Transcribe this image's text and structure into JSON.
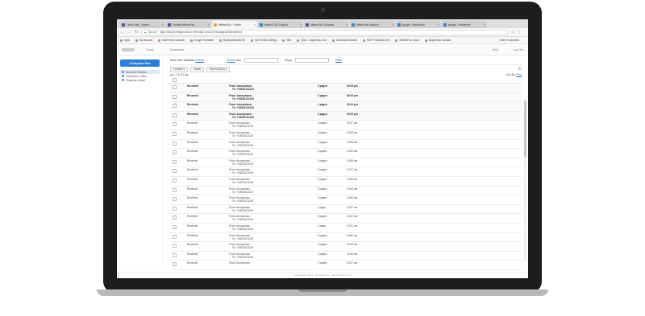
{
  "browser": {
    "tabs": [
      {
        "label": "Yahoo Mail - Receiv",
        "color": "#6b3fa0",
        "active": false
      },
      {
        "label": "Contact #MetroFax",
        "color": "#6b3fa0",
        "active": false
      },
      {
        "label": "#MetroFAX - Folder",
        "color": "#e8a23a",
        "active": true
      },
      {
        "label": "#Metro FAX Support",
        "color": "#2c8cc8",
        "active": false
      },
      {
        "label": "#MetroFAX Services",
        "color": "#6b3fa0",
        "active": false
      },
      {
        "label": "#MetroFax Inbound",
        "color": "#2c8cc8",
        "active": false
      },
      {
        "label": "google - Recherche",
        "color": "#3a7bd5",
        "active": false
      },
      {
        "label": "google - Recherche",
        "color": "#3a7bd5",
        "active": false
      }
    ],
    "tab_close": "×",
    "secure_label": "Secure",
    "url": "https://faxout.infagnosticon.metrofax.com/v2/messages/folders/inbox"
  },
  "bookmarks": {
    "items": [
      "Apps",
      "Bookmarks",
      "Dapemoss Canada",
      "Google Translate",
      "My Dashboards Re",
      "My Review Listings",
      "Wiki",
      "Q&A - Dapemoss Can",
      "Scheduled Articles",
      "RMF Publication Re",
      "#MetroFax Cloud",
      "Dapemoss Canada"
    ],
    "other": "Other bookmarks"
  },
  "app": {
    "nav": [
      "Home",
      "Dashboard"
    ],
    "header_right": [
      "Help",
      "Log Out"
    ],
    "compose_label": "Compose Fax",
    "folders": [
      {
        "label": "Received Folders",
        "active": true
      },
      {
        "label": "Confirmed Letters",
        "active": false
      },
      {
        "label": "Outgoing Queue",
        "active": false
      }
    ]
  },
  "filters": {
    "read_view": "Read View:",
    "current": "Current",
    "deleted": "Deleted",
    "search": "Search",
    "view": "View:",
    "status": "Status:",
    "reset": "Reset"
  },
  "buttons": {
    "forward": "Forward ▾",
    "delete": "Delete",
    "more": "More Actions ▾"
  },
  "pager": {
    "text": "1 - 14 of 14",
    "sort_by": "Sort By:",
    "sort_value": "Time"
  },
  "messages": [
    {
      "status": "Received",
      "from": "From: Anonymous",
      "to": "To: +15032121119",
      "pages": "3 pages",
      "time": "03:04 pm",
      "unread": true
    },
    {
      "status": "Received",
      "from": "From: Anonymous",
      "to": "To: +15032121119",
      "pages": "3 pages",
      "time": "03:03 pm",
      "unread": true
    },
    {
      "status": "Received",
      "from": "From: Anonymous",
      "to": "To: +15032121119",
      "pages": "1 pages",
      "time": "03:04 pm",
      "unread": true
    },
    {
      "status": "Received",
      "from": "From: Anonymous",
      "to": "To: +15032121119",
      "pages": "3 pages",
      "time": "03:02 pm",
      "unread": true
    },
    {
      "status": "Received",
      "from": "From: Anonymous",
      "to": "To: +15032121119",
      "pages": "3 pages",
      "time": "02:57 pm",
      "unread": false
    },
    {
      "status": "Received",
      "from": "From: Anonymous",
      "to": "To: +15032121119",
      "pages": "3 pages",
      "time": "10:59 am",
      "unread": false
    },
    {
      "status": "Received",
      "from": "From: Anonymous",
      "to": "To: +15032121119",
      "pages": "7 pages",
      "time": "10:56 am",
      "unread": false
    },
    {
      "status": "Received",
      "from": "From: Anonymous",
      "to": "To: +15032121119",
      "pages": "3 pages",
      "time": "10:59 am",
      "unread": false
    },
    {
      "status": "Received",
      "from": "From: Anonymous",
      "to": "To: +15032121119",
      "pages": "3 pages",
      "time": "10:58 am",
      "unread": false
    },
    {
      "status": "Received",
      "from": "From: Anonymous",
      "to": "To: +15032121119",
      "pages": "3 pages",
      "time": "10:57 am",
      "unread": false
    },
    {
      "status": "Received",
      "from": "From: Anonymous",
      "to": "To: +15032121119",
      "pages": "3 pages",
      "time": "10:56 am",
      "unread": false
    },
    {
      "status": "Received",
      "from": "From: Anonymous",
      "to": "To: +15032121119",
      "pages": "3 pages",
      "time": "10:55 am",
      "unread": false
    },
    {
      "status": "Received",
      "from": "From: Anonymous",
      "to": "To: +15032121119",
      "pages": "3 pages",
      "time": "10:54 am",
      "unread": false
    },
    {
      "status": "Received",
      "from": "From: Anonymous",
      "to": "To: +15032121119",
      "pages": "1 page",
      "time": "10:57 am",
      "unread": false
    },
    {
      "status": "Received",
      "from": "From: Anonymous",
      "to": "To: +15032121119",
      "pages": "3 pages",
      "time": "10:52 am",
      "unread": false
    },
    {
      "status": "Received",
      "from": "From: Anonymous",
      "to": "To: +15032121119",
      "pages": "1 page",
      "time": "10:51 am",
      "unread": false
    },
    {
      "status": "Received",
      "from": "From: Anonymous",
      "to": "To: +15032121119",
      "pages": "3 pages",
      "time": "10:50 am",
      "unread": false
    },
    {
      "status": "Received",
      "from": "From: Anonymous",
      "to": "To: +15032121119",
      "pages": "3 pages",
      "time": "10:49 am",
      "unread": false
    },
    {
      "status": "Received",
      "from": "From: Anonymous",
      "to": "To: +15032121119",
      "pages": "3 pages",
      "time": "10:48 am",
      "unread": false
    },
    {
      "status": "Received",
      "from": "From: Anonymous",
      "to": "",
      "pages": "7 pages",
      "time": "10:47 am",
      "unread": false
    }
  ],
  "footer": "Copyright © 2017 · MetroFax Inc. · MetroFAX 5.1.1.0"
}
